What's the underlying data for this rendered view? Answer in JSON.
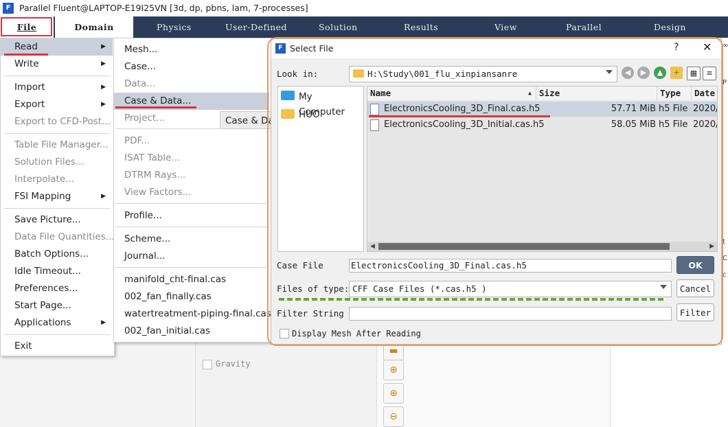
{
  "window": {
    "title": "Parallel Fluent@LAPTOP-E19I25VN  [3d, dp, pbns, lam, 7-processes]",
    "app_icon_letter": "F"
  },
  "ribbon": {
    "tabs": [
      "File",
      "Domain",
      "Physics",
      "User-Defined",
      "Solution",
      "Results",
      "View",
      "Parallel",
      "Design"
    ],
    "accent_color": "#2b3c5a"
  },
  "file_menu": {
    "items": [
      {
        "label": "Read",
        "has_arrow": true
      },
      {
        "label": "Write",
        "has_arrow": true
      },
      {
        "label": "Import",
        "has_arrow": true
      },
      {
        "label": "Export",
        "has_arrow": true
      },
      {
        "label": "Export to CFD-Post...",
        "disabled": true
      },
      {
        "label": "Table File Manager...",
        "disabled": true
      },
      {
        "label": "Solution Files...",
        "disabled": true
      },
      {
        "label": "Interpolate...",
        "disabled": true
      },
      {
        "label": "FSI Mapping",
        "has_arrow": true
      },
      {
        "label": "Save Picture..."
      },
      {
        "label": "Data File Quantities...",
        "disabled": true
      },
      {
        "label": "Batch Options..."
      },
      {
        "label": "Idle Timeout..."
      },
      {
        "label": "Preferences..."
      },
      {
        "label": "Start Page..."
      },
      {
        "label": "Applications",
        "has_arrow": true
      },
      {
        "label": "Exit"
      }
    ]
  },
  "read_submenu": {
    "items": [
      {
        "label": "Mesh..."
      },
      {
        "label": "Case..."
      },
      {
        "label": "Data...",
        "disabled": true
      },
      {
        "label": "Case & Data..."
      },
      {
        "label": "Project...",
        "disabled": true
      },
      {
        "label": "PDF...",
        "disabled": true
      },
      {
        "label": "ISAT Table...",
        "disabled": true
      },
      {
        "label": "DTRM Rays...",
        "disabled": true
      },
      {
        "label": "View Factors...",
        "disabled": true
      },
      {
        "label": "Profile..."
      },
      {
        "label": "Scheme..."
      },
      {
        "label": "Journal..."
      },
      {
        "label": "manifold_cht-final.cas"
      },
      {
        "label": "002_fan_finally.cas"
      },
      {
        "label": "watertreatment-piping-final.cas"
      },
      {
        "label": "002_fan_initial.cas"
      }
    ]
  },
  "tooltip": {
    "text": "Case & Da"
  },
  "workspace": {
    "gravity_label": "Gravity"
  },
  "dialog": {
    "title": "Select File",
    "help_glyph": "?",
    "close_glyph": "✕",
    "look_in_label": "Look in:",
    "look_in_value": "H:\\Study\\001_flu_xinpiansanre",
    "sidebar": [
      "My Computer",
      "HUO"
    ],
    "columns": [
      "Name",
      "Size",
      "Type",
      "Date"
    ],
    "files": [
      {
        "name": "ElectronicsCooling_3D_Final.cas.h5",
        "size": "57.71 MiB",
        "type": "h5 File",
        "date": "2020/"
      },
      {
        "name": "ElectronicsCooling_3D_Initial.cas.h5",
        "size": "58.05 MiB",
        "type": "h5 File",
        "date": "2020/"
      }
    ],
    "case_file_label": "Case File",
    "case_file_value": "ElectronicsCooling_3D_Final.cas.h5",
    "files_of_type_label": "Files of type:",
    "files_of_type_value": "CFF Case Files (*.cas.h5 )",
    "filter_string_label": "Filter String",
    "filter_string_value": "",
    "display_mesh_label": "Display Mesh After Reading",
    "ok_label": "OK",
    "cancel_label": "Cancel",
    "filter_label": "Filter"
  },
  "highlight_colors": {
    "red": "#d9363e",
    "orange": "#e79a52",
    "green": "#6aa832"
  }
}
